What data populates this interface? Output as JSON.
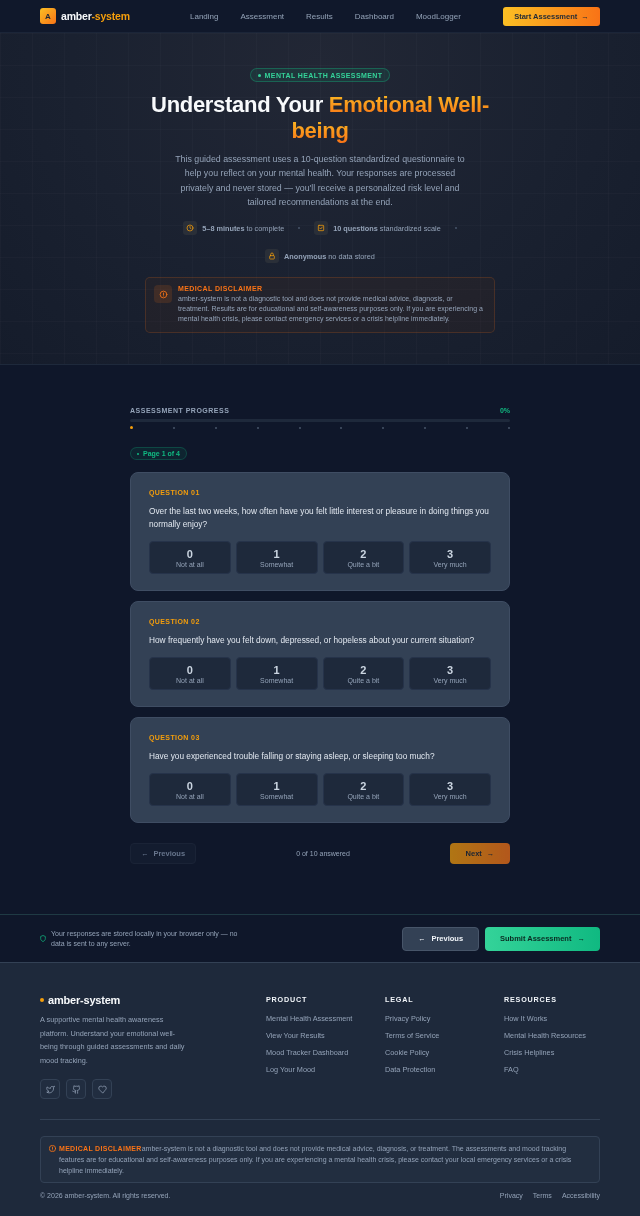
{
  "header": {
    "logo_letter": "A",
    "brand": {
      "lead": "amber",
      "accent": "-system"
    },
    "nav": [
      {
        "label": "Landing",
        "selected": false
      },
      {
        "label": "Assessment",
        "selected": false
      },
      {
        "label": "Results",
        "selected": false
      },
      {
        "label": "Dashboard",
        "selected": false
      },
      {
        "label": "MoodLogger",
        "selected": false
      }
    ],
    "cta": {
      "label": "Start Assessment",
      "arrow": "→"
    }
  },
  "hero": {
    "badge": "MENTAL HEALTH ASSESSMENT",
    "title": {
      "lead": "Understand Your",
      "highlight": "Emotional Well-being"
    },
    "intro": "This guided assessment uses a 10-question standardized questionnaire to help you reflect on your mental health. Your responses are processed privately and never stored — you'll receive a personalized risk level and tailored recommendations at the end.",
    "stats": [
      {
        "kind": "clock",
        "text": "**5–8 minutes** to complete"
      },
      {
        "kind": "checklist",
        "text": "**10 questions** standardized scale"
      },
      {
        "kind": "lock",
        "text": "**Anonymous** no data stored"
      }
    ],
    "disclaimer": {
      "title": "MEDICAL DISCLAIMER",
      "text": "amber-system is not a diagnostic tool and does not provide medical advice, diagnosis, or treatment. Results are for educational and self-awareness purposes only. If you are experiencing a mental health crisis, please contact emergency services or a crisis helpline immediately."
    }
  },
  "progress": {
    "label": "ASSESSMENT PROGRESS",
    "percent": "0%",
    "level": 0,
    "steps": [
      {
        "current": true
      },
      {
        "current": false
      },
      {
        "current": false
      },
      {
        "current": false
      },
      {
        "current": false
      },
      {
        "current": false
      },
      {
        "current": false
      },
      {
        "current": false
      },
      {
        "current": false
      },
      {
        "current": false
      }
    ]
  },
  "page_indicator": "Page 1 of 4",
  "questions": [
    {
      "number": "QUESTION 01",
      "text": "Over the last two weeks, how often have you felt little interest or pleasure in doing things you normally enjoy?",
      "options": [
        {
          "value": "0",
          "label": "Not at all",
          "selected": false
        },
        {
          "value": "1",
          "label": "Somewhat",
          "selected": false
        },
        {
          "value": "2",
          "label": "Quite a bit",
          "selected": false
        },
        {
          "value": "3",
          "label": "Very much",
          "selected": false
        }
      ]
    },
    {
      "number": "QUESTION 02",
      "text": "How frequently have you felt down, depressed, or hopeless about your current situation?",
      "options": [
        {
          "value": "0",
          "label": "Not at all",
          "selected": false
        },
        {
          "value": "1",
          "label": "Somewhat",
          "selected": false
        },
        {
          "value": "2",
          "label": "Quite a bit",
          "selected": false
        },
        {
          "value": "3",
          "label": "Very much",
          "selected": false
        }
      ]
    },
    {
      "number": "QUESTION 03",
      "text": "Have you experienced trouble falling or staying asleep, or sleeping too much?",
      "options": [
        {
          "value": "0",
          "label": "Not at all",
          "selected": false
        },
        {
          "value": "1",
          "label": "Somewhat",
          "selected": false
        },
        {
          "value": "2",
          "label": "Quite a bit",
          "selected": false
        },
        {
          "value": "3",
          "label": "Very much",
          "selected": false
        }
      ]
    }
  ],
  "pager": {
    "previous": {
      "label": "Previous",
      "arrow": "←",
      "disabled": true
    },
    "status": "0 of 10 answered",
    "next": {
      "label": "Next",
      "arrow": "→",
      "disabled": true
    }
  },
  "action_bar": {
    "note": "Your responses are stored locally in your browser only — no data is sent to any server.",
    "previous": {
      "label": "Previous",
      "arrow": "←"
    },
    "submit": {
      "label": "Submit Assessment",
      "arrow": "→"
    }
  },
  "footer": {
    "brand": "amber-system",
    "description": "A supportive mental health awareness platform. Understand your emotional well-being through guided assessments and daily mood tracking.",
    "social": [
      {
        "kind": "bird"
      },
      {
        "kind": "cat"
      },
      {
        "kind": "heart"
      }
    ],
    "columns": [
      {
        "heading": "PRODUCT",
        "links": [
          "Mental Health Assessment",
          "View Your Results",
          "Mood Tracker Dashboard",
          "Log Your Mood"
        ]
      },
      {
        "heading": "LEGAL",
        "links": [
          "Privacy Policy",
          "Terms of Service",
          "Cookie Policy",
          "Data Protection"
        ]
      },
      {
        "heading": "RESOURCES",
        "links": [
          "How It Works",
          "Mental Health Resources",
          "Crisis Helplines",
          "FAQ"
        ]
      }
    ],
    "disclaimer": {
      "title": "MEDICAL DISCLAIMER",
      "text": "amber-system is not a diagnostic tool and does not provide medical advice, diagnosis, or treatment. The assessments and mood tracking features are for educational and self-awareness purposes only. If you are experiencing a mental health crisis, please contact your local emergency services or a crisis helpline immediately."
    },
    "copyright": "© 2026 amber-system. All rights reserved.",
    "legal_links": [
      "Privacy",
      "Terms",
      "Accessibility"
    ]
  }
}
